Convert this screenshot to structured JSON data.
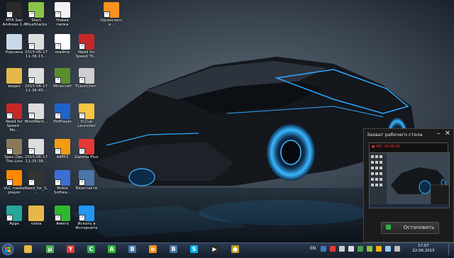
{
  "desktop": {
    "icons": [
      {
        "label": "MTA San Andreas 1.4",
        "icon": "mta-icon",
        "color": "#2a2a2a"
      },
      {
        "label": "Start BlueStacks",
        "icon": "bluestacks-icon",
        "color": "#8bc34a"
      },
      {
        "label": "Новая папка",
        "icon": "document-icon",
        "color": "#f2f2f2"
      },
      {
        "label": "Одноклассн...",
        "icon": "odnoklassniki-icon",
        "color": "#f7931e"
      },
      {
        "label": "Корзина",
        "icon": "recycle-bin-icon",
        "color": "#c8d8e8"
      },
      {
        "label": "2015-06-17 11-36-15...",
        "icon": "video-file-icon",
        "color": "#dddddd"
      },
      {
        "label": "readme",
        "icon": "text-file-icon",
        "color": "#ffffff"
      },
      {
        "label": "Need for Speed Th...",
        "icon": "nfs-icon",
        "color": "#c62828"
      },
      {
        "label": "видео",
        "icon": "folder-icon",
        "color": "#e6b84a"
      },
      {
        "label": "2015-06-17 11-36-45...",
        "icon": "video-file-icon",
        "color": "#dddddd"
      },
      {
        "label": "Minecraft",
        "icon": "minecraft-icon",
        "color": "#5a8f2e"
      },
      {
        "label": "TLauncher-...",
        "icon": "tlauncher-icon",
        "color": "#cfcfcf"
      },
      {
        "label": "Need for Speed - Mo...",
        "icon": "nfs-icon",
        "color": "#c62828"
      },
      {
        "label": "MostWant...",
        "icon": "video-file-icon",
        "color": "#dddddd"
      },
      {
        "label": "PotPlayer",
        "icon": "potplayer-icon",
        "color": "#1e63c9"
      },
      {
        "label": "ICCup Launcher",
        "icon": "iccup-icon",
        "color": "#f4c542"
      },
      {
        "label": "Spec.Ops. The Line",
        "icon": "specops-icon",
        "color": "#8a7a5a"
      },
      {
        "label": "2015-06-17 11-35-38...",
        "icon": "video-file-icon",
        "color": "#dddddd"
      },
      {
        "label": "AIMP3",
        "icon": "aimp-icon",
        "color": "#f39c12"
      },
      {
        "label": "Garena Plus",
        "icon": "garena-icon",
        "color": "#e53935"
      },
      {
        "label": "VLC media player",
        "icon": "vlc-icon",
        "color": "#ff8800"
      },
      {
        "label": "Need_for_S...",
        "icon": "video-file-icon",
        "color": "#333333"
      },
      {
        "label": "Nokia Softwa...",
        "icon": "nokia-icon",
        "color": "#3a6fd8"
      },
      {
        "label": "Вконтакте",
        "icon": "vk-icon",
        "color": "#4a76a8"
      },
      {
        "label": "Apps",
        "icon": "apps-icon",
        "color": "#26a69a"
      },
      {
        "label": "nokia",
        "icon": "folder-icon",
        "color": "#e6b84a"
      },
      {
        "label": "Амиго",
        "icon": "amigo-icon",
        "color": "#2eb82e"
      },
      {
        "label": "Искать в Интернете",
        "icon": "search-web-icon",
        "color": "#2196f3"
      }
    ]
  },
  "capture": {
    "title": "Захват рабочего стола",
    "rec_text": "● REC 00:00:00",
    "stop_label": "Остановить",
    "stop_color": "#2fb240"
  },
  "taskbar": {
    "apps": [
      {
        "name": "explorer",
        "icon": "folder-icon",
        "color": "#e6b84a",
        "glyph": ""
      },
      {
        "name": "torrent",
        "icon": "utorrent-icon",
        "color": "#4caf50",
        "glyph": "µ"
      },
      {
        "name": "yandex",
        "icon": "yandex-browser-icon",
        "color": "#e53935",
        "glyph": "Y"
      },
      {
        "name": "chrome",
        "icon": "chrome-icon",
        "color": "#34a853",
        "glyph": "C"
      },
      {
        "name": "amigo",
        "icon": "amigo-icon",
        "color": "#2eb82e",
        "glyph": "A"
      },
      {
        "name": "vk",
        "icon": "vk-icon",
        "color": "#4a76a8",
        "glyph": "B"
      },
      {
        "name": "ok",
        "icon": "odnoklassniki-icon",
        "color": "#f7931e",
        "glyph": "o"
      },
      {
        "name": "vk2",
        "icon": "vk-icon",
        "color": "#4a76a8",
        "glyph": "B"
      },
      {
        "name": "skype",
        "icon": "skype-icon",
        "color": "#00aff0",
        "glyph": "S"
      },
      {
        "name": "media",
        "icon": "media-player-icon",
        "color": "#2b2b2b",
        "glyph": "▶"
      },
      {
        "name": "capture",
        "icon": "camera-icon",
        "color": "#c0a020",
        "glyph": "●"
      }
    ],
    "language": "EN",
    "time": "17:07",
    "date": "22.06.2015"
  }
}
